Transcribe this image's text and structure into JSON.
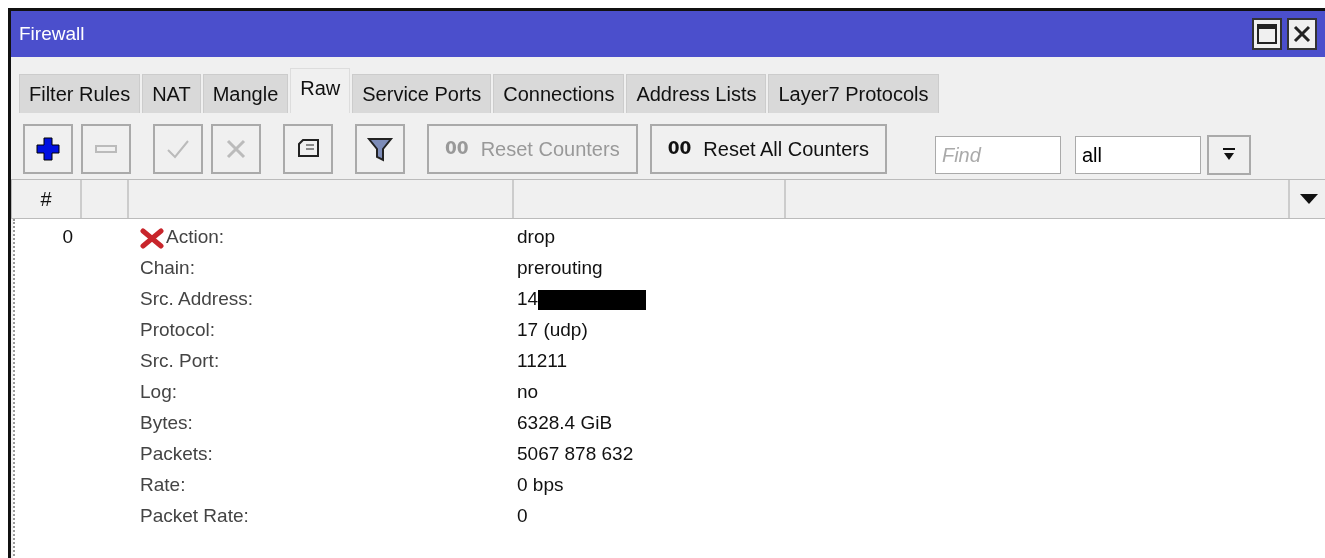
{
  "window": {
    "title": "Firewall"
  },
  "tabs": [
    {
      "label": "Filter Rules",
      "selected": false
    },
    {
      "label": "NAT",
      "selected": false
    },
    {
      "label": "Mangle",
      "selected": false
    },
    {
      "label": "Raw",
      "selected": true
    },
    {
      "label": "Service Ports",
      "selected": false
    },
    {
      "label": "Connections",
      "selected": false
    },
    {
      "label": "Address Lists",
      "selected": false
    },
    {
      "label": "Layer7 Protocols",
      "selected": false
    }
  ],
  "toolbar": {
    "icon_buttons": [
      {
        "kind": "add",
        "disabled": false
      },
      {
        "kind": "remove",
        "disabled": true
      },
      {
        "kind": "enable",
        "disabled": true
      },
      {
        "kind": "disable",
        "disabled": true
      },
      {
        "kind": "comment",
        "disabled": false
      },
      {
        "kind": "filter",
        "disabled": false
      }
    ],
    "text_buttons": [
      {
        "prefix": "00",
        "label": "Reset Counters",
        "disabled": true
      },
      {
        "prefix": "00",
        "label": "Reset All Counters",
        "disabled": false
      }
    ],
    "find": {
      "placeholder": "Find"
    },
    "filter_select": {
      "value": "all"
    }
  },
  "table": {
    "columns": [
      {
        "kind": "number",
        "label": "#"
      },
      {
        "kind": "blank"
      },
      {
        "kind": "blank"
      },
      {
        "kind": "blank"
      },
      {
        "kind": "blank"
      }
    ],
    "rules": [
      {
        "number": "0",
        "fields": [
          {
            "label": "Action:",
            "value": "drop",
            "kind": "action"
          },
          {
            "label": "Chain:",
            "value": "prerouting",
            "kind": "text"
          },
          {
            "label": "Src. Address:",
            "value": "14",
            "kind": "redacted"
          },
          {
            "label": "Protocol:",
            "value": "17 (udp)",
            "kind": "text"
          },
          {
            "label": "Src. Port:",
            "value": "11211",
            "kind": "text"
          },
          {
            "label": "Log:",
            "value": "no",
            "kind": "text"
          },
          {
            "label": "Bytes:",
            "value": "6328.4 GiB",
            "kind": "text"
          },
          {
            "label": "Packets:",
            "value": "5067 878 632",
            "kind": "text"
          },
          {
            "label": "Rate:",
            "value": "0 bps",
            "kind": "text"
          },
          {
            "label": "Packet Rate:",
            "value": "0",
            "kind": "text"
          }
        ]
      }
    ]
  }
}
